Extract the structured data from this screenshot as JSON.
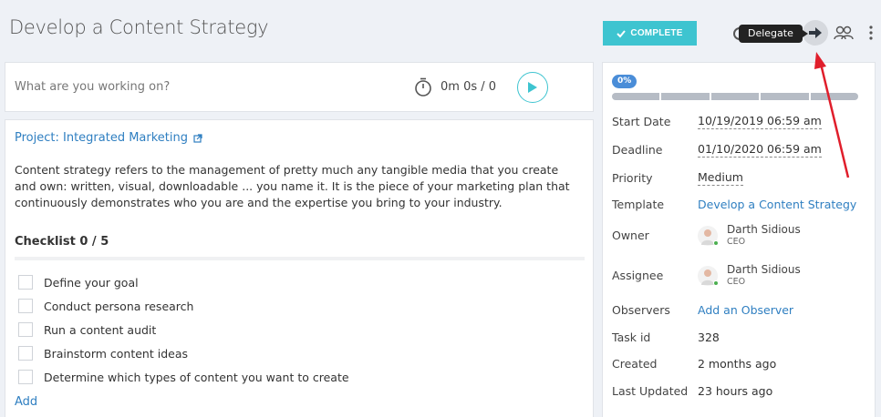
{
  "task": {
    "title": "Develop a Content Strategy",
    "complete_label": "COMPLETE",
    "delegate_tooltip": "Delegate"
  },
  "timer": {
    "placeholder": "What are you working on?",
    "value": "0m 0s / 0"
  },
  "main": {
    "project_label": "Project: Integrated Marketing",
    "description": "Content strategy refers to the management of pretty much any tangible media that you create and own: written, visual, downloadable ... you name it. It is the piece of your marketing plan that continuously demonstrates who you are and the expertise you bring to your industry.",
    "checklist_title": "Checklist 0 / 5",
    "checklist_items": [
      "Define your goal",
      "Conduct persona research",
      "Run a content audit",
      "Brainstorm content ideas",
      "Determine which types of content you want to create"
    ],
    "add_label": "Add"
  },
  "side": {
    "progress_label": "0%",
    "progress_value": 0,
    "start_date_label": "Start Date",
    "start_date": "10/19/2019 06:59 am",
    "deadline_label": "Deadline",
    "deadline": "01/10/2020 06:59 am",
    "priority_label": "Priority",
    "priority": "Medium",
    "template_label": "Template",
    "template": "Develop a Content Strategy",
    "owner_label": "Owner",
    "owner_name": "Darth Sidious",
    "owner_role": "CEO",
    "assignee_label": "Assignee",
    "assignee_name": "Darth Sidious",
    "assignee_role": "CEO",
    "observers_label": "Observers",
    "observers_action": "Add an Observer",
    "task_id_label": "Task id",
    "task_id": "328",
    "created_label": "Created",
    "created": "2 months ago",
    "updated_label": "Last Updated",
    "updated": "23 hours ago"
  },
  "colors": {
    "accent": "#3ec4d0",
    "link": "#2f7fc1",
    "annotation_arrow": "#e01e2b"
  },
  "icons": {
    "complete": "check-icon",
    "delegate": "arrow-right-icon",
    "users": "users-icon",
    "more": "more-vertical-icon",
    "timer": "stopwatch-icon",
    "play": "play-icon",
    "external": "external-link-icon"
  }
}
